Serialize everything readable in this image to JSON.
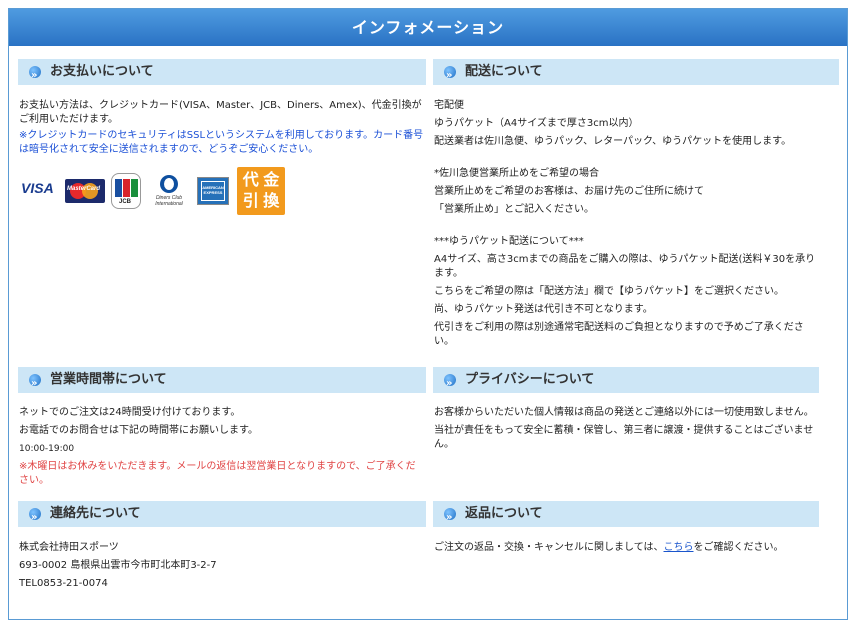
{
  "banner": {
    "title": "インフォメーション"
  },
  "payment": {
    "heading": "お支払いについて",
    "text": "お支払い方法は、クレジットカード(VISA、Master、JCB、Diners、Amex)、代金引換がご利用いただけます。",
    "note": "※クレジットカードのセキュリティはSSLというシステムを利用しております。カード番号は暗号化されて安全に送信されますので、どうぞご安心ください。",
    "cards": {
      "visa": "VISA",
      "master": "MasterCard",
      "jcb": "JCB",
      "diners": "Diners Club International",
      "amex": "AMERICAN EXPRESS",
      "cod1": "代 金",
      "cod2": "引 換"
    }
  },
  "shipping": {
    "heading": "配送について",
    "l1": "宅配便",
    "l2": "ゆうパケット（A4サイズまで厚さ3cm以内）",
    "l3": "配送業者は佐川急便、ゆうパック、レターパック、ゆうパケットを使用します。",
    "l4": "*佐川急便営業所止めをご希望の場合",
    "l5": "営業所止めをご希望のお客様は、お届け先のご住所に続けて",
    "l6": "「営業所止め」とご記入ください。",
    "l7": "***ゆうパケット配送について***",
    "l8": "A4サイズ、高さ3cmまでの商品をご購入の際は、ゆうパケット配送(送料￥30を承ります。",
    "l9": "こちらをご希望の際は「配送方法」欄で【ゆうパケット】をご選択ください。",
    "l10": "尚、ゆうパケット発送は代引き不可となります。",
    "l11": "代引きをご利用の際は別途通常宅配送料のご負担となりますので予めご了承ください。"
  },
  "hours": {
    "heading": "営業時間帯について",
    "l1": "ネットでのご注文は24時間受け付けております。",
    "l2": "お電話でのお問合せは下記の時間帯にお願いします。",
    "l3": "10:00-19:00",
    "l4": "※木曜日はお休みをいただきます。メールの返信は翌営業日となりますので、ご了承ください。"
  },
  "privacy": {
    "heading": "プライバシーについて",
    "l1": "お客様からいただいた個人情報は商品の発送とご連絡以外には一切使用致しません。",
    "l2": "当社が責任をもって安全に蓄積・保管し、第三者に譲渡・提供することはございません。"
  },
  "contact": {
    "heading": "連絡先について",
    "l1": "株式会社持田スポーツ",
    "l2": "693-0002 島根県出雲市今市町北本町3-2-7",
    "l3": "TEL0853-21-0074"
  },
  "returns": {
    "heading": "返品について",
    "pre": "ご注文の返品・交換・キャンセルに関しましては、",
    "link": "こちら",
    "post": "をご確認ください。"
  }
}
